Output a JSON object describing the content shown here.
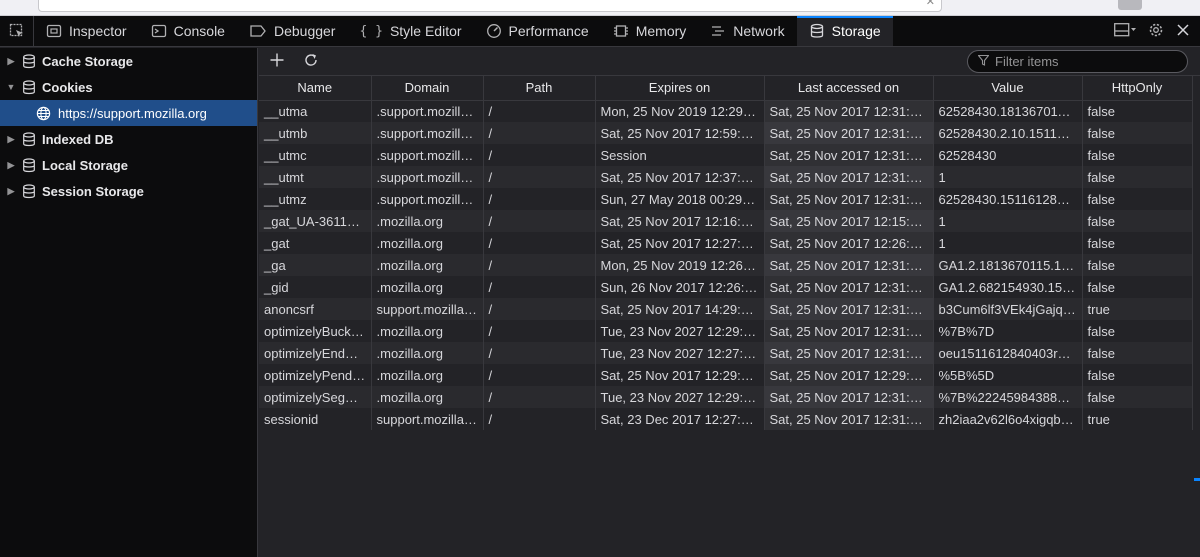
{
  "toolbar": {
    "tabs": [
      {
        "label": "Inspector",
        "icon": "inspector-icon"
      },
      {
        "label": "Console",
        "icon": "console-icon"
      },
      {
        "label": "Debugger",
        "icon": "debugger-icon"
      },
      {
        "label": "Style Editor",
        "icon": "style-editor-icon"
      },
      {
        "label": "Performance",
        "icon": "performance-icon"
      },
      {
        "label": "Memory",
        "icon": "memory-icon"
      },
      {
        "label": "Network",
        "icon": "network-icon"
      },
      {
        "label": "Storage",
        "icon": "storage-icon"
      }
    ],
    "active_tab": "Storage",
    "accent": "#0a84ff"
  },
  "sidebar": {
    "items": [
      {
        "label": "Cache Storage",
        "expanded": false
      },
      {
        "label": "Cookies",
        "expanded": true
      },
      {
        "label": "Indexed DB",
        "expanded": false
      },
      {
        "label": "Local Storage",
        "expanded": false
      },
      {
        "label": "Session Storage",
        "expanded": false
      }
    ],
    "selected_child": "https://support.mozilla.org"
  },
  "main": {
    "filter_placeholder": "Filter items",
    "columns": [
      "Name",
      "Domain",
      "Path",
      "Expires on",
      "Last accessed on",
      "Value",
      "HttpOnly"
    ],
    "rows": [
      [
        "__utma",
        ".support.mozill…",
        "/",
        "Mon, 25 Nov 2019 12:29:…",
        "Sat, 25 Nov 2017 12:31:5…",
        "62528430.181367011…",
        "false"
      ],
      [
        "__utmb",
        ".support.mozill…",
        "/",
        "Sat, 25 Nov 2017 12:59:1…",
        "Sat, 25 Nov 2017 12:31:5…",
        "62528430.2.10.15116…",
        "false"
      ],
      [
        "__utmc",
        ".support.mozill…",
        "/",
        "Session",
        "Sat, 25 Nov 2017 12:31:5…",
        "62528430",
        "false"
      ],
      [
        "__utmt",
        ".support.mozill…",
        "/",
        "Sat, 25 Nov 2017 12:37:2…",
        "Sat, 25 Nov 2017 12:31:5…",
        "1",
        "false"
      ],
      [
        "__utmz",
        ".support.mozill…",
        "/",
        "Sun, 27 May 2018 00:29:…",
        "Sat, 25 Nov 2017 12:31:5…",
        "62528430.151161284…",
        "false"
      ],
      [
        "_gat_UA-36116…",
        ".mozilla.org",
        "/",
        "Sat, 25 Nov 2017 12:16:4…",
        "Sat, 25 Nov 2017 12:15:4…",
        "1",
        "false"
      ],
      [
        "_gat",
        ".mozilla.org",
        "/",
        "Sat, 25 Nov 2017 12:27:4…",
        "Sat, 25 Nov 2017 12:26:4…",
        "1",
        "false"
      ],
      [
        "_ga",
        ".mozilla.org",
        "/",
        "Mon, 25 Nov 2019 12:26:…",
        "Sat, 25 Nov 2017 12:31:5…",
        "GA1.2.1813670115.15…",
        "false"
      ],
      [
        "_gid",
        ".mozilla.org",
        "/",
        "Sun, 26 Nov 2017 12:26:…",
        "Sat, 25 Nov 2017 12:31:5…",
        "GA1.2.682154930.15…",
        "false"
      ],
      [
        "anoncsrf",
        "support.mozilla…",
        "/",
        "Sat, 25 Nov 2017 14:29:1…",
        "Sat, 25 Nov 2017 12:31:5…",
        "b3Cum6lf3VEk4jGajq…",
        "true"
      ],
      [
        "optimizelyBuck…",
        ".mozilla.org",
        "/",
        "Tue, 23 Nov 2027 12:29:…",
        "Sat, 25 Nov 2017 12:31:5…",
        "%7B%7D",
        "false"
      ],
      [
        "optimizelyEndU…",
        ".mozilla.org",
        "/",
        "Tue, 23 Nov 2027 12:27:…",
        "Sat, 25 Nov 2017 12:31:5…",
        "oeu1511612840403r0…",
        "false"
      ],
      [
        "optimizelyPend…",
        ".mozilla.org",
        "/",
        "Sat, 25 Nov 2017 12:29:3…",
        "Sat, 25 Nov 2017 12:29:1…",
        "%5B%5D",
        "false"
      ],
      [
        "optimizelySeg…",
        ".mozilla.org",
        "/",
        "Tue, 23 Nov 2027 12:29:…",
        "Sat, 25 Nov 2017 12:31:5…",
        "%7B%22245984388…",
        "false"
      ],
      [
        "sessionid",
        "support.mozilla…",
        "/",
        "Sat, 23 Dec 2017 12:27:2…",
        "Sat, 25 Nov 2017 12:31:5…",
        "zh2iaa2v62l6o4xigqb…",
        "true"
      ]
    ]
  }
}
